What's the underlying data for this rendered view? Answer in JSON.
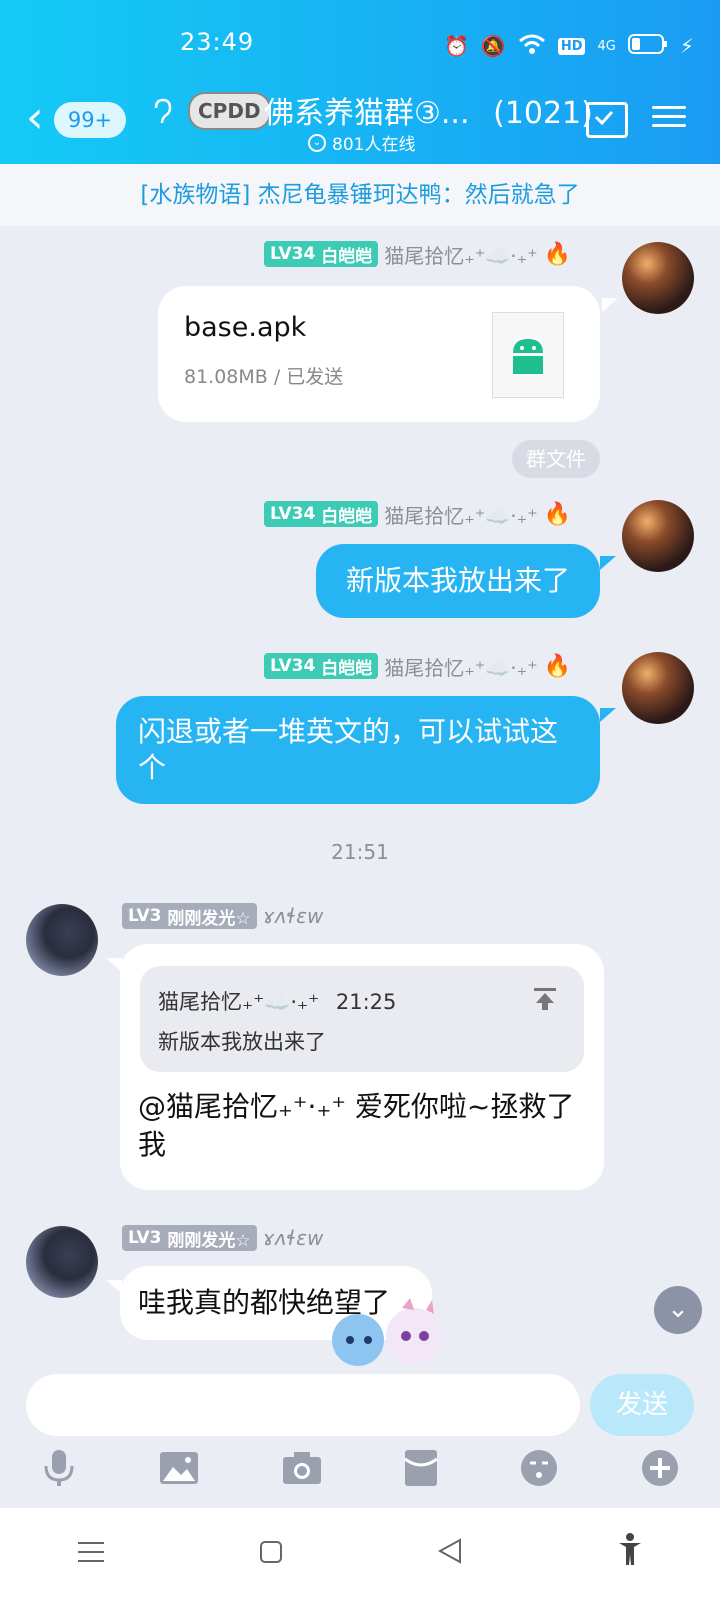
{
  "status": {
    "time": "23:49",
    "icons": [
      "alarm-icon",
      "mute-icon",
      "wifi-icon",
      "hd-icon",
      "signal-4g-icon",
      "battery-icon",
      "charging-icon"
    ],
    "hd": "HD",
    "net": "4G"
  },
  "header": {
    "back_badge": "99+",
    "title": "佛系养猫群③...",
    "member_count": "(1021)",
    "online": "801人在线",
    "tag": "CPDD"
  },
  "notice": "[水族物语] 杰尼龟暴锤珂达鸭：然后就急了",
  "messages": [
    {
      "level": "LV34",
      "title": "白皑皑",
      "name": "猫尾拾忆₊⁺☁️·₊⁺",
      "file": {
        "name": "base.apk",
        "info": "81.08MB / 已发送"
      },
      "tag": "群文件"
    },
    {
      "level": "LV34",
      "title": "白皑皑",
      "name": "猫尾拾忆₊⁺☁️·₊⁺",
      "text": "新版本我放出来了"
    },
    {
      "level": "LV34",
      "title": "白皑皑",
      "name": "猫尾拾忆₊⁺☁️·₊⁺",
      "text": "闪退或者一堆英文的，可以试试这个"
    },
    {
      "level": "LV3",
      "title": "刚刚发光☆",
      "name": "ɤʌɬɛw",
      "quote_name": "猫尾拾忆₊⁺☁️·₊⁺",
      "quote_time": "21:25",
      "quote_text": "新版本我放出来了",
      "text": "@猫尾拾忆₊⁺·₊⁺ 爱死你啦~拯救了我"
    },
    {
      "level": "LV3",
      "title": "刚刚发光☆",
      "name": "ɤʌɬɛw",
      "text": "哇我真的都快绝望了"
    }
  ],
  "timestamp": "21:51",
  "input": {
    "placeholder": "",
    "send_label": "发送"
  },
  "colors": {
    "header_start": "#14CBF5",
    "header_end": "#1A9CF3",
    "bubble_blue": "#27B4F3",
    "level_teal": "#3DCBB6",
    "level_gray": "#A7ACBB"
  }
}
